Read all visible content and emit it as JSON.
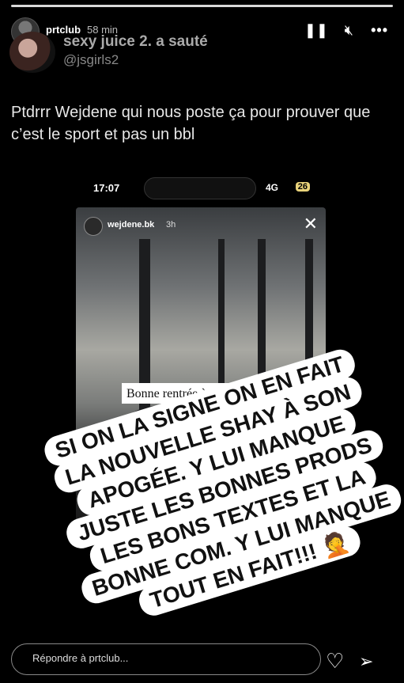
{
  "story": {
    "username": "prtclub",
    "time": "58 min",
    "pause_icon": "pause-icon",
    "mute_icon": "speaker-muted-icon",
    "more_icon": "more-icon"
  },
  "tweet": {
    "name": "sexy juice 2. a sauté",
    "handle": "@jsgirls2",
    "text": "Ptdrrr Wejdene qui nous poste ça pour prouver que c’est le sport et pas un bbl"
  },
  "phone_status": {
    "time": "17:07",
    "signal": "4G",
    "battery": "26"
  },
  "inner_story": {
    "username": "wejdene.bk",
    "time": "3h",
    "caption": "Bonne rentrée à tous",
    "caption_emoji": "❤"
  },
  "overlay_lines": [
    "Si on la signe on en fait",
    "la nouvelle Shay à son",
    "apogée. Y lui manque",
    "juste les bonnes prods",
    "les bons textes et la",
    "bonne com. Y lui manque",
    "tout en fait!!! 🤦"
  ],
  "reply": {
    "placeholder": "Répondre à prtclub..."
  },
  "colors": {
    "background": "#000000",
    "heart": "#d4132a",
    "battery": "#e8d27a"
  }
}
